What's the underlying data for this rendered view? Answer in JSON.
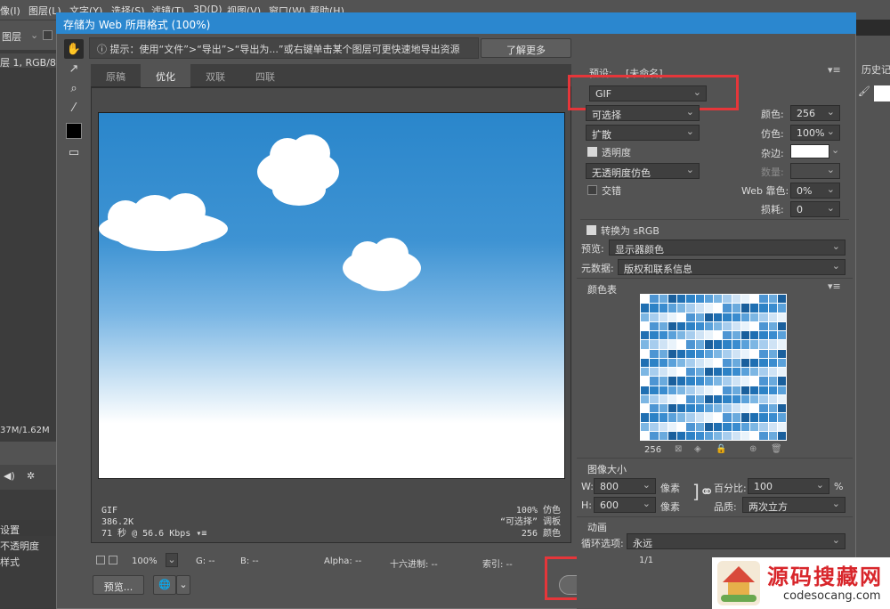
{
  "menubar": {
    "items": [
      "像(I)",
      "图层(L)",
      "文字(Y)",
      "选择(S)",
      "滤镜(T)",
      "3D(D)",
      "视图(V)",
      "窗口(W)",
      "帮助(H)"
    ]
  },
  "left_bg": {
    "option_label": "图层",
    "doc_info": "层 1, RGB/8#)",
    "doc_size": "37M/1.62M",
    "layer_labels": [
      "设置",
      "不透明度",
      "样式"
    ]
  },
  "right_bg": {
    "history_label": "历史记"
  },
  "dialog": {
    "title": "存储为 Web 所用格式 (100%)",
    "hint": "提示：使用“文件”>“导出”>“导出为...”或右键单击某个图层可更快速地导出资源",
    "learn_more": "了解更多",
    "tabs": [
      "原稿",
      "优化",
      "双联",
      "四联"
    ],
    "active_tab": "优化"
  },
  "preview_info": {
    "left": [
      "GIF",
      "386.2K",
      "71 秒 @ 56.6 Kbps"
    ],
    "right": [
      "100% 仿色",
      "“可选择” 调板",
      "256 颜色"
    ]
  },
  "statusbar": {
    "zoom": "100%",
    "g": "G: --",
    "b": "B: --",
    "alpha": "Alpha: --",
    "hex": "十六进制: --",
    "index": "索引: --"
  },
  "bottom_buttons": {
    "preview": "预览...",
    "save": "存储..."
  },
  "settings": {
    "preset_label": "预设:",
    "preset_value": "[未命名]",
    "format": "GIF",
    "palette": "可选择",
    "dither_algo": "扩散",
    "transparency_label": "透明度",
    "transparency_checked": true,
    "no_transparency_dither": "无透明度仿色",
    "interlace_label": "交错",
    "interlace_checked": false,
    "colors_label": "颜色:",
    "colors_value": "256",
    "dither_label": "仿色:",
    "dither_value": "100%",
    "matte_label": "杂边:",
    "amount_label": "数量:",
    "web_snap_label": "Web 靠色:",
    "web_snap_value": "0%",
    "lossy_label": "损耗:",
    "lossy_value": "0",
    "convert_srgb": "转换为 sRGB",
    "convert_srgb_checked": true,
    "preview_label": "预览:",
    "preview_value": "显示器颜色",
    "metadata_label": "元数据:",
    "metadata_value": "版权和联系信息"
  },
  "color_table": {
    "title": "颜色表",
    "count": "256"
  },
  "image_size": {
    "title": "图像大小",
    "w_label": "W:",
    "w_value": "800",
    "h_label": "H:",
    "h_value": "600",
    "unit": "像素",
    "percent_label": "百分比:",
    "percent_value": "100",
    "percent_unit": "%",
    "quality_label": "品质:",
    "quality_value": "两次立方"
  },
  "animation": {
    "title": "动画",
    "loop_label": "循环选项:",
    "loop_value": "永远",
    "frame_counter": "1/1"
  },
  "watermark": {
    "title": "源码搜藏网",
    "url": "codesocang.com"
  }
}
